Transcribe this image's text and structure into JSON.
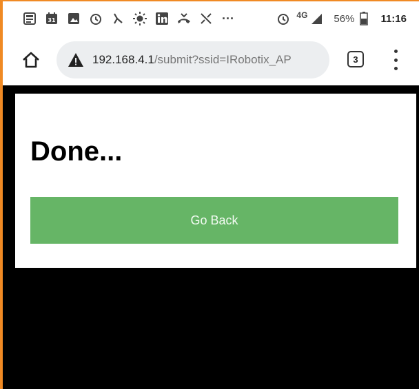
{
  "status_bar": {
    "icons": [
      "news-icon",
      "calendar-icon",
      "gallery-icon",
      "alarm-icon",
      "missed-call-icon",
      "brightness-icon",
      "linkedin-icon",
      "call-icon",
      "network-icon",
      "more-icon",
      "alarm-icon",
      "signal-icon",
      "battery-icon"
    ],
    "calendar_day": "31",
    "more": "···",
    "network": "4G",
    "battery": "56%",
    "time": "11:16"
  },
  "browser": {
    "url_host": "192.168.4.1",
    "url_path": "/submit?ssid=IRobotix_AP",
    "tab_count": "3"
  },
  "page": {
    "heading": "Done...",
    "button_label": "Go Back",
    "button_color": "#66b566"
  }
}
